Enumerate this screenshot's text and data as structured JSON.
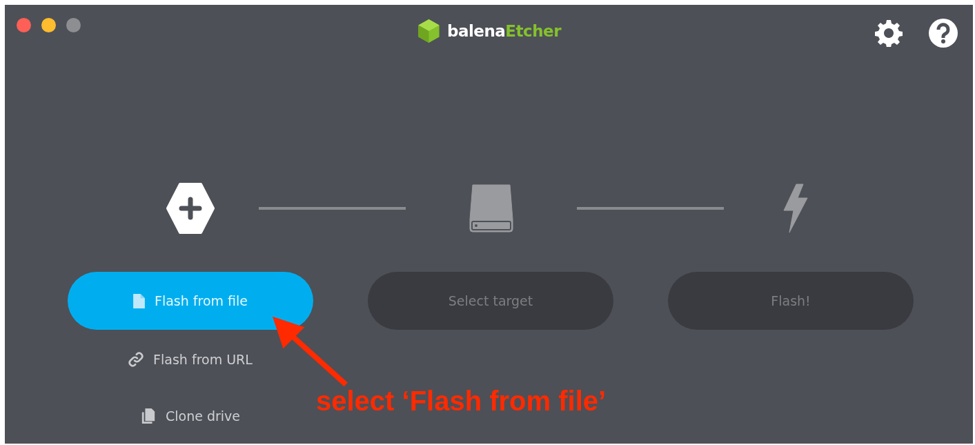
{
  "window": {
    "traffic_lights": [
      {
        "color": "#fe5f57"
      },
      {
        "color": "#febc2e"
      },
      {
        "color": "#8d8e92"
      }
    ]
  },
  "logo": {
    "brand": "balena",
    "product": "Etcher"
  },
  "steps": [
    {
      "kind": "image",
      "enabled": true,
      "button": "Flash from file",
      "options": [
        {
          "kind": "url",
          "label": "Flash from URL"
        },
        {
          "kind": "clone",
          "label": "Clone drive"
        }
      ]
    },
    {
      "kind": "target",
      "enabled": false,
      "button": "Select target"
    },
    {
      "kind": "flash",
      "enabled": false,
      "button": "Flash!"
    }
  ],
  "annotation": {
    "text": "select ‘Flash from file’"
  }
}
